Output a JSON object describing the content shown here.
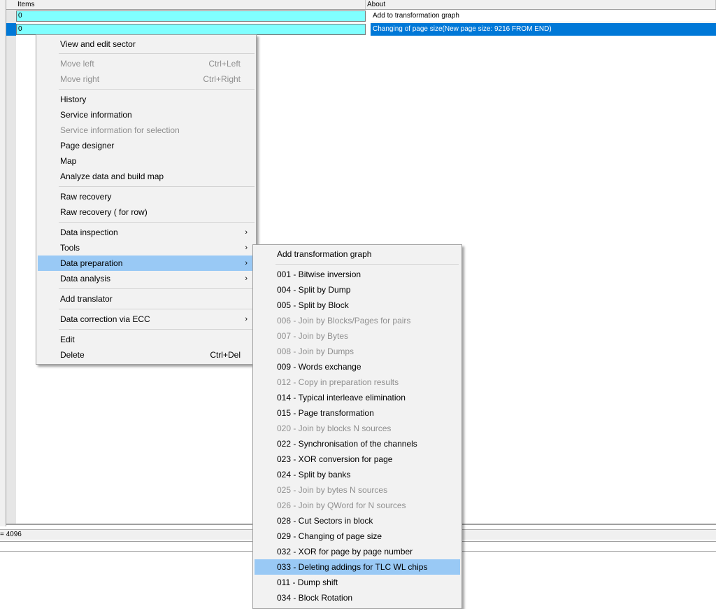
{
  "grid": {
    "columns": [
      "Items",
      "About"
    ],
    "rows": [
      {
        "items": "0",
        "about": "Add to transformation graph"
      },
      {
        "items": "0",
        "about": "Changing of page size(New page size: 9216  FROM END)"
      }
    ]
  },
  "status": {
    "text": "= 4096"
  },
  "context_menu": {
    "view_edit": "View and edit sector",
    "move_left": "Move left",
    "move_left_sc": "Ctrl+Left",
    "move_right": "Move right",
    "move_right_sc": "Ctrl+Right",
    "history": "History",
    "service_info": "Service information",
    "service_info_sel": "Service information for selection",
    "page_designer": "Page designer",
    "map": "Map",
    "analyze": "Analyze data and build map",
    "raw_recovery": "Raw recovery",
    "raw_recovery_row": "Raw recovery ( for row)",
    "data_inspection": "Data inspection",
    "tools": "Tools",
    "data_preparation": "Data preparation",
    "data_analysis": "Data analysis",
    "add_translator": "Add translator",
    "ecc": "Data correction via ECC",
    "edit": "Edit",
    "delete": "Delete",
    "delete_sc": "Ctrl+Del",
    "arrow_glyph": "›"
  },
  "submenu": {
    "add_graph": "Add transformation graph",
    "items": [
      {
        "label": "001 - Bitwise inversion",
        "enabled": true
      },
      {
        "label": "004 - Split by Dump",
        "enabled": true
      },
      {
        "label": "005 - Split by Block",
        "enabled": true
      },
      {
        "label": "006 - Join by Blocks/Pages for pairs",
        "enabled": false
      },
      {
        "label": "007 - Join by Bytes",
        "enabled": false
      },
      {
        "label": "008 - Join by Dumps",
        "enabled": false
      },
      {
        "label": "009 - Words exchange",
        "enabled": true
      },
      {
        "label": "012 - Copy in preparation results",
        "enabled": false
      },
      {
        "label": "014 - Typical interleave elimination",
        "enabled": true
      },
      {
        "label": "015 - Page transformation",
        "enabled": true
      },
      {
        "label": "020 - Join by blocks N sources",
        "enabled": false
      },
      {
        "label": "022 - Synchronisation of the channels",
        "enabled": true
      },
      {
        "label": "023 - XOR conversion for page",
        "enabled": true
      },
      {
        "label": "024 - Split by banks",
        "enabled": true
      },
      {
        "label": "025 - Join by bytes N sources",
        "enabled": false
      },
      {
        "label": "026 - Join by QWord for N sources",
        "enabled": false
      },
      {
        "label": "028 - Cut Sectors in block",
        "enabled": true
      },
      {
        "label": "029 - Changing of page size",
        "enabled": true
      },
      {
        "label": "032 - XOR for page by page number",
        "enabled": true
      },
      {
        "label": "033 - Deleting addings for TLC WL chips",
        "enabled": true,
        "highlighted": true
      },
      {
        "label": "011 - Dump shift",
        "enabled": true
      },
      {
        "label": "034 - Block Rotation",
        "enabled": true
      }
    ]
  },
  "colors": {
    "cell_cyan": "#80ffff",
    "selection": "#0078d7",
    "menu_highlight": "#99c9f5",
    "disabled_text": "#8f8f8f"
  }
}
